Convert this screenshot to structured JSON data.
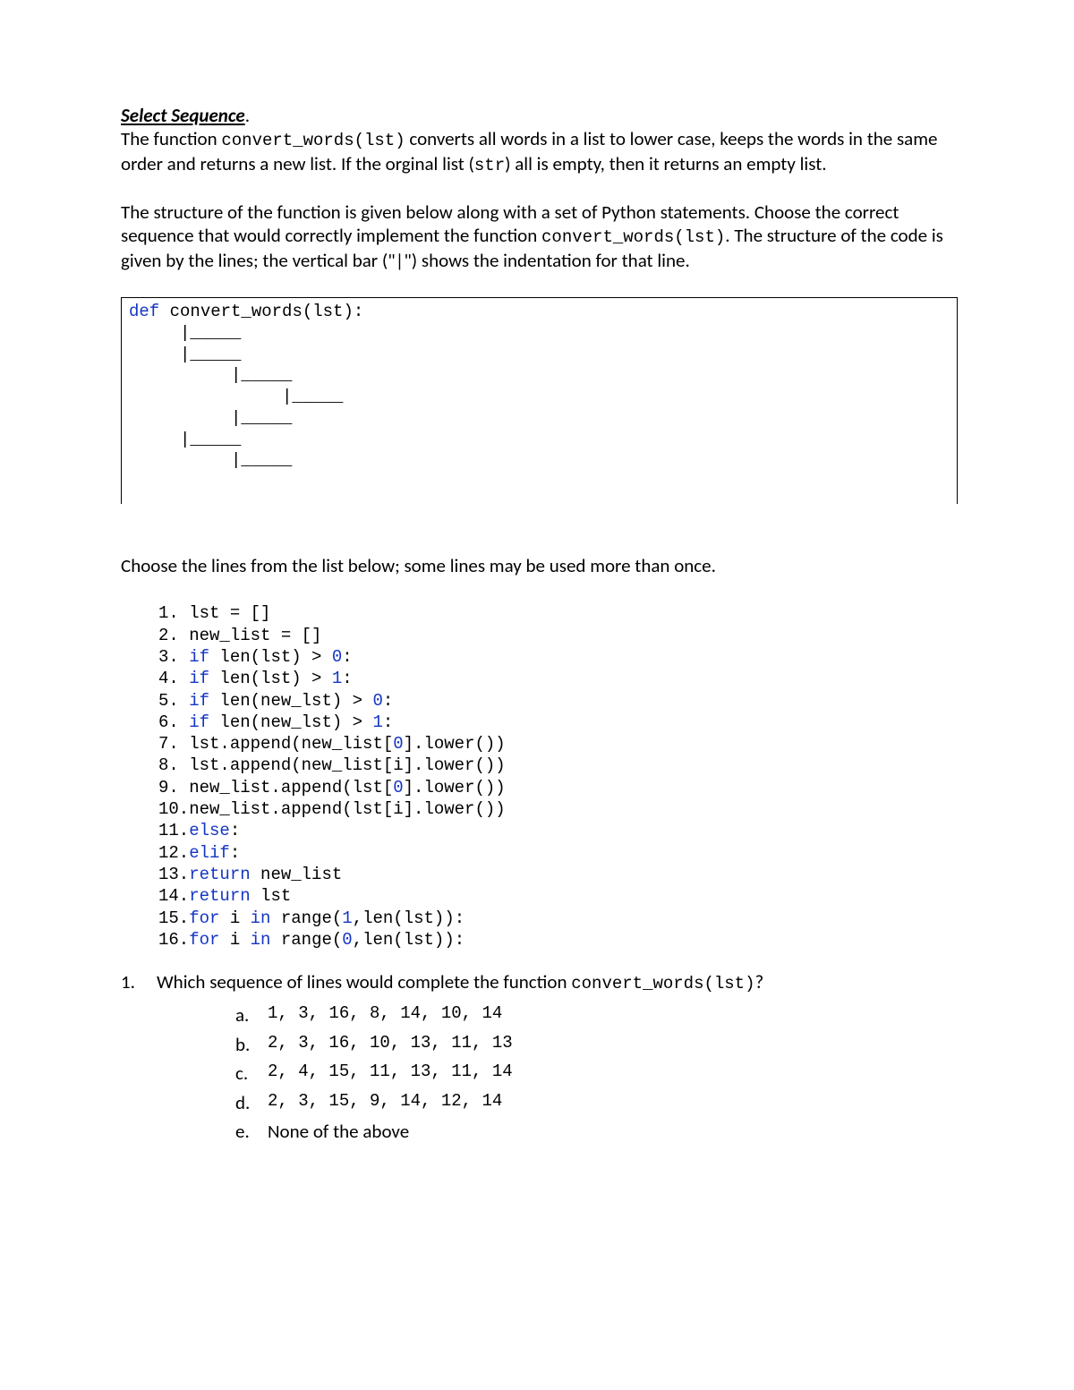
{
  "heading": "Select Sequence",
  "para1_parts": {
    "p1": "The function ",
    "code1": "convert_words(lst)",
    "p2": " converts all words in a list to lower case, keeps the words in the same order and returns a new list.  If the orginal list (",
    "code2": "str",
    "p3": ") all is empty, then it returns an empty list."
  },
  "para2_parts": {
    "p1": "The structure of the function is given below along with a set of Python statements.  Choose the correct sequence that would correctly implement the function ",
    "code1": "convert_words(lst)",
    "p2": ".  The structure of the code is given by the lines; the vertical bar (\"|\") shows the indentation for that line."
  },
  "code_structure": {
    "kw_def": "def",
    "sig": " convert_words(lst):",
    "lines": [
      "     |_____",
      "     |_____",
      "          |_____",
      "               |_____",
      "          |_____",
      "     |_____",
      "          |_____"
    ]
  },
  "choose_line": "Choose the lines from the list below; some lines may be used more than once.",
  "statements": [
    {
      "n": "1. ",
      "pre": "",
      "kw": "",
      "post": "lst = []"
    },
    {
      "n": "2. ",
      "pre": "",
      "kw": "",
      "post": "new_list = []"
    },
    {
      "n": "3. ",
      "pre": "",
      "kw": "if",
      "mid": " len(lst) > ",
      "num": "0",
      "post2": ":"
    },
    {
      "n": "4. ",
      "pre": "",
      "kw": "if",
      "mid": " len(lst) > ",
      "num": "1",
      "post2": ":"
    },
    {
      "n": "5. ",
      "pre": "",
      "kw": "if",
      "mid": " len(new_lst) > ",
      "num": "0",
      "post2": ":"
    },
    {
      "n": "6. ",
      "pre": "",
      "kw": "if",
      "mid": " len(new_lst) > ",
      "num": "1",
      "post2": ":"
    },
    {
      "n": "7. ",
      "pre": "lst.append(new_list[",
      "num": "0",
      "post2": "].lower())"
    },
    {
      "n": "8. ",
      "pre": "lst.append(new_list[i].lower())"
    },
    {
      "n": "9. ",
      "pre": "new_list.append(lst[",
      "num": "0",
      "post2": "].lower())"
    },
    {
      "n": "10.",
      "pre": "new_list.append(lst[i].lower())"
    },
    {
      "n": "11.",
      "kw": "else",
      "post2": ":"
    },
    {
      "n": "12.",
      "kw": "elif",
      "post2": ":"
    },
    {
      "n": "13.",
      "kw": "return",
      "post2": " new_list"
    },
    {
      "n": "14.",
      "kw": "return",
      "post2": " lst"
    },
    {
      "n": "15.",
      "kw": "for",
      "mid": " i ",
      "kw2": "in",
      "mid2": " range(",
      "num": "1",
      "post2": ",len(lst)):"
    },
    {
      "n": "16.",
      "kw": "for",
      "mid": " i ",
      "kw2": "in",
      "mid2": " range(",
      "num": "0",
      "post2": ",len(lst)):"
    }
  ],
  "question": {
    "num": "1.",
    "text_pre": "Which sequence of lines would complete the function ",
    "code": "convert_words(lst)",
    "text_post": "?"
  },
  "answers": [
    {
      "letter": "a.",
      "text": "1, 3, 16, 8, 14, 10, 14"
    },
    {
      "letter": "b.",
      "text": "2, 3, 16, 10, 13, 11, 13"
    },
    {
      "letter": "c.",
      "text": "2, 4, 15, 11, 13, 11, 14"
    },
    {
      "letter": "d.",
      "text": "2, 3, 15, 9, 14, 12, 14"
    },
    {
      "letter": "e.",
      "text": "None of the above",
      "plain": true
    }
  ]
}
